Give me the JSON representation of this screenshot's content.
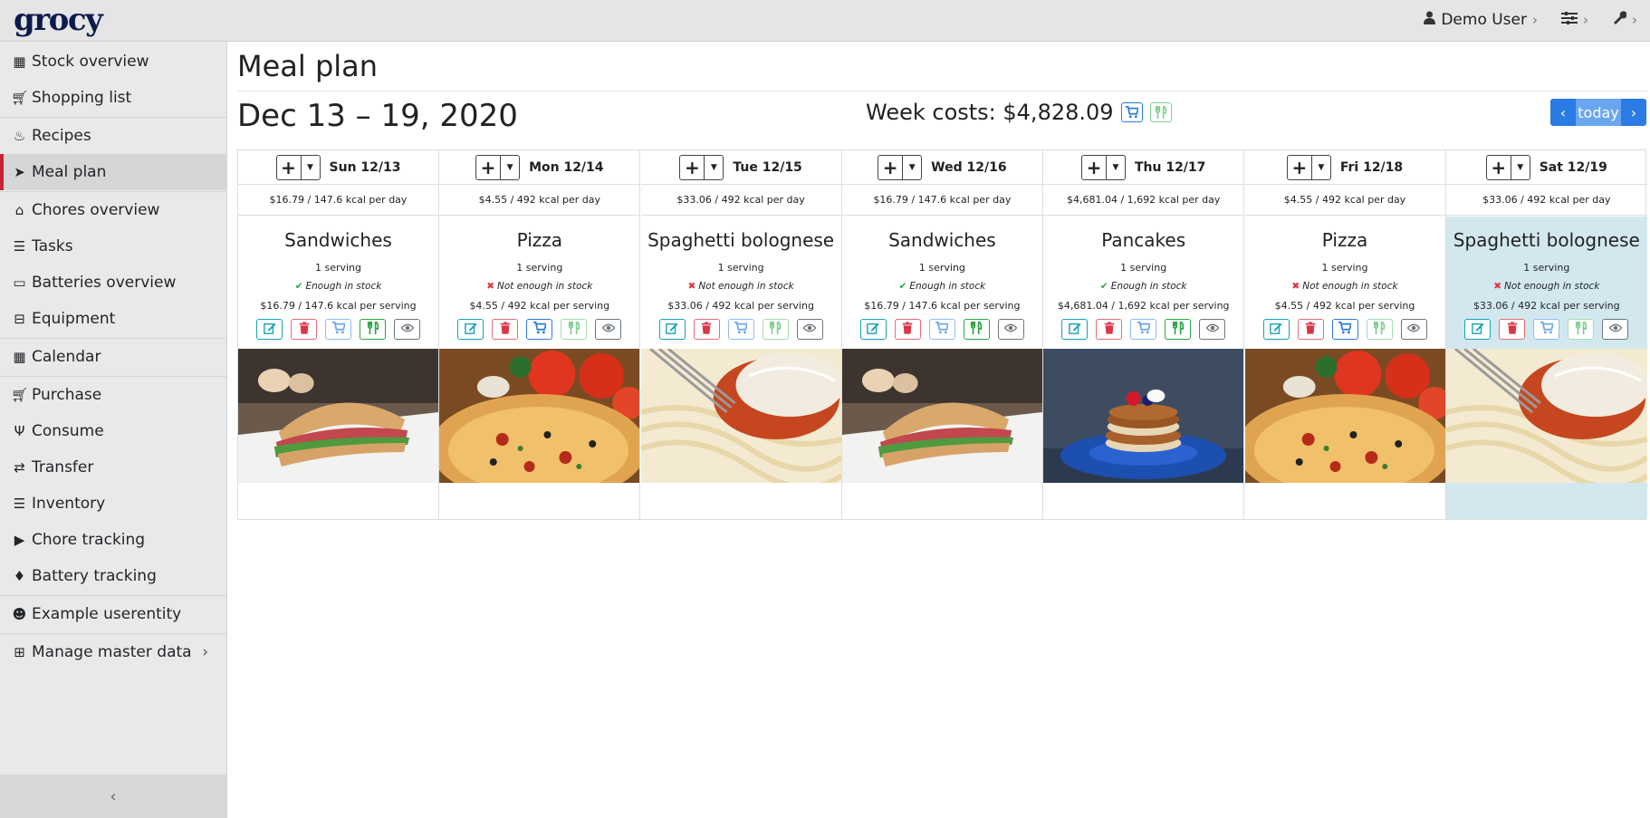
{
  "app": {
    "logo": "grocy"
  },
  "topbar": {
    "user": "Demo User"
  },
  "sidebar": {
    "items": [
      {
        "label": "Stock overview",
        "icon": "box-icon"
      },
      {
        "label": "Shopping list",
        "icon": "cart-icon"
      },
      {
        "label": "Recipes",
        "icon": "pot-icon"
      },
      {
        "label": "Meal plan",
        "icon": "paper-plane-icon"
      },
      {
        "label": "Chores overview",
        "icon": "home-icon"
      },
      {
        "label": "Tasks",
        "icon": "tasks-icon"
      },
      {
        "label": "Batteries overview",
        "icon": "battery-icon"
      },
      {
        "label": "Equipment",
        "icon": "toolbox-icon"
      },
      {
        "label": "Calendar",
        "icon": "calendar-icon"
      },
      {
        "label": "Purchase",
        "icon": "cart-icon"
      },
      {
        "label": "Consume",
        "icon": "utensils-icon"
      },
      {
        "label": "Transfer",
        "icon": "exchange-icon"
      },
      {
        "label": "Inventory",
        "icon": "list-icon"
      },
      {
        "label": "Chore tracking",
        "icon": "play-icon"
      },
      {
        "label": "Battery tracking",
        "icon": "fire-icon"
      },
      {
        "label": "Example userentity",
        "icon": "smile-icon"
      },
      {
        "label": "Manage master data",
        "icon": "table-icon"
      }
    ]
  },
  "main": {
    "title": "Meal plan",
    "week_range": "Dec 13 – 19, 2020",
    "week_costs": "Week costs: $4,828.09",
    "today_label": "today"
  },
  "days": [
    {
      "label": "Sun 12/13",
      "summary": "$16.79 / 147.6 kcal per day",
      "recipe": "Sandwiches",
      "servings": "1 serving",
      "stock_ok": true,
      "stock": "Enough in stock",
      "per_serving": "$16.79 / 147.6 kcal per serving"
    },
    {
      "label": "Mon 12/14",
      "summary": "$4.55 / 492 kcal per day",
      "recipe": "Pizza",
      "servings": "1 serving",
      "stock_ok": false,
      "stock": "Not enough in stock",
      "per_serving": "$4.55 / 492 kcal per serving"
    },
    {
      "label": "Tue 12/15",
      "summary": "$33.06 / 492 kcal per day",
      "recipe": "Spaghetti bolognese",
      "servings": "1 serving",
      "stock_ok": false,
      "stock": "Not enough in stock",
      "per_serving": "$33.06 / 492 kcal per serving"
    },
    {
      "label": "Wed 12/16",
      "summary": "$16.79 / 147.6 kcal per day",
      "recipe": "Sandwiches",
      "servings": "1 serving",
      "stock_ok": true,
      "stock": "Enough in stock",
      "per_serving": "$16.79 / 147.6 kcal per serving"
    },
    {
      "label": "Thu 12/17",
      "summary": "$4,681.04 / 1,692 kcal per day",
      "recipe": "Pancakes",
      "servings": "1 serving",
      "stock_ok": true,
      "stock": "Enough in stock",
      "per_serving": "$4,681.04 / 1,692 kcal per serving"
    },
    {
      "label": "Fri 12/18",
      "summary": "$4.55 / 492 kcal per day",
      "recipe": "Pizza",
      "servings": "1 serving",
      "stock_ok": false,
      "stock": "Not enough in stock",
      "per_serving": "$4.55 / 492 kcal per serving"
    },
    {
      "label": "Sat 12/19",
      "summary": "$33.06 / 492 kcal per day",
      "recipe": "Spaghetti bolognese",
      "servings": "1 serving",
      "stock_ok": false,
      "stock": "Not enough in stock",
      "per_serving": "$33.06 / 492 kcal per serving"
    }
  ],
  "colors": {
    "accent": "#2a7be4",
    "active_marker": "#c82333",
    "ok": "#28a745",
    "danger": "#dc3545",
    "info": "#17a2b8",
    "today_bg": "#d2e8ee"
  }
}
